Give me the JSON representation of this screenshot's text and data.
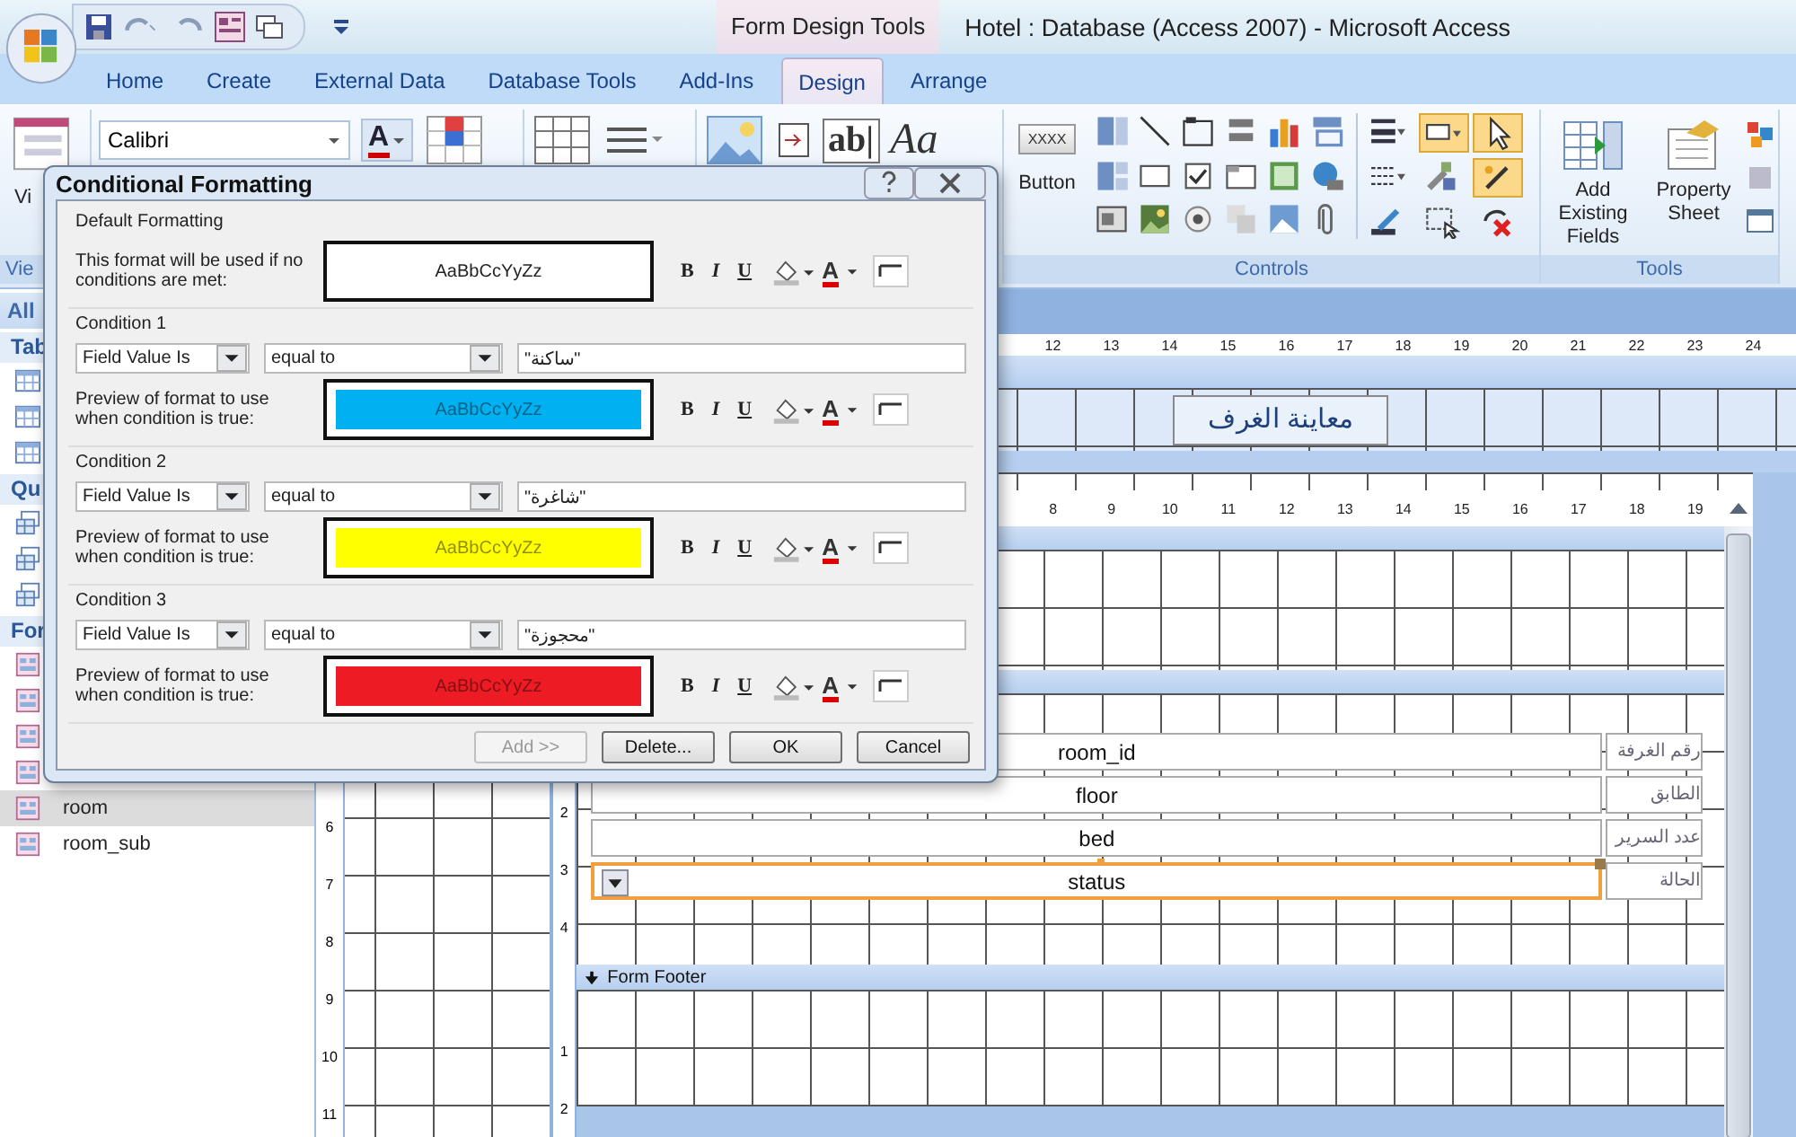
{
  "window": {
    "context_label": "Form Design Tools",
    "title": "Hotel : Database (Access 2007) - Microsoft Access"
  },
  "tabs": [
    {
      "label": "Home",
      "selected": false
    },
    {
      "label": "Create",
      "selected": false
    },
    {
      "label": "External Data",
      "selected": false
    },
    {
      "label": "Database Tools",
      "selected": false
    },
    {
      "label": "Add-Ins",
      "selected": false
    },
    {
      "label": "Design",
      "selected": true
    },
    {
      "label": "Arrange",
      "selected": false
    }
  ],
  "ribbon": {
    "view_button": "Vi",
    "view_group": "Vie",
    "font_name": "Calibri",
    "font_color_glyph": "A",
    "textbox_glyph": "ab|",
    "label_glyph": "Aa",
    "button_face": "XXXX",
    "button_label": "Button",
    "controls_group": "Controls",
    "tools_buttons": [
      "Add Existing Fields",
      "Property Sheet"
    ],
    "tools_group": "Tools"
  },
  "nav": {
    "header": "All",
    "groups": [
      {
        "label": "Tab",
        "kind": "table",
        "items": [
          {
            "selected": false
          },
          {
            "selected": false
          },
          {
            "selected": false
          }
        ]
      },
      {
        "label": "Qu",
        "kind": "query",
        "items": [
          {
            "selected": false
          },
          {
            "selected": false
          },
          {
            "selected": false
          }
        ]
      },
      {
        "label": "For",
        "kind": "form",
        "items": [
          {
            "selected": false
          },
          {
            "selected": false
          },
          {
            "selected": false
          },
          {
            "selected": false
          },
          {
            "name": "room",
            "selected": true
          },
          {
            "name": "room_sub",
            "selected": false
          }
        ]
      }
    ]
  },
  "designer": {
    "outer_ruler": [
      "12",
      "13",
      "14",
      "15",
      "16",
      "17",
      "18",
      "19",
      "20",
      "21",
      "22",
      "23",
      "24"
    ],
    "header_label": "معاينة الغرف",
    "outer_vruler": [
      "6",
      "7",
      "8",
      "9",
      "10",
      "11"
    ],
    "inner_ruler": [
      "8",
      "9",
      "10",
      "11",
      "12",
      "13",
      "14",
      "15",
      "16",
      "17",
      "18",
      "19"
    ],
    "detail_vruler": [
      "2",
      "3",
      "4"
    ],
    "fields": [
      {
        "value": "room_id",
        "label": "رقم الغرفة",
        "kind": "textbox",
        "selected": false
      },
      {
        "value": "floor",
        "label": "الطابق",
        "kind": "textbox",
        "selected": false
      },
      {
        "value": "bed",
        "label": "عدد السرير",
        "kind": "textbox",
        "selected": false
      },
      {
        "value": "status",
        "label": "الحالة",
        "kind": "combo",
        "selected": true
      }
    ],
    "footer_title": "Form Footer",
    "footer_vruler": [
      "1",
      "2"
    ]
  },
  "dialog": {
    "title": "Conditional Formatting",
    "default": {
      "heading": "Default Formatting",
      "description": "This format will be used if no conditions are met:",
      "preview": "AaBbCcYyZz",
      "format_buttons": [
        "B",
        "I",
        "U"
      ],
      "font_color": "A"
    },
    "conditions": [
      {
        "heading": "Condition 1",
        "field": "Field Value Is",
        "operator": "equal to",
        "value": "\"ساكنة\"",
        "description": "Preview of format to use when condition is true:",
        "preview": "AaBbCcYyZz",
        "color": "#00b0f0",
        "format_buttons": [
          "B",
          "I",
          "U"
        ],
        "font_color": "A"
      },
      {
        "heading": "Condition 2",
        "field": "Field Value Is",
        "operator": "equal to",
        "value": "\"شاغرة\"",
        "description": "Preview of format to use when condition is true:",
        "preview": "AaBbCcYyZz",
        "color": "#ffff00",
        "format_buttons": [
          "B",
          "I",
          "U"
        ],
        "font_color": "A"
      },
      {
        "heading": "Condition 3",
        "field": "Field Value Is",
        "operator": "equal to",
        "value": "\"محجوزة\"",
        "description": "Preview of format to use when condition is true:",
        "preview": "AaBbCcYyZz",
        "color": "#ed1c24",
        "format_buttons": [
          "B",
          "I",
          "U"
        ],
        "font_color": "A"
      }
    ],
    "buttons": [
      {
        "label": "Add >>",
        "disabled": true
      },
      {
        "label": "Delete...",
        "disabled": false
      },
      {
        "label": "OK",
        "disabled": false
      },
      {
        "label": "Cancel",
        "disabled": false
      }
    ]
  }
}
